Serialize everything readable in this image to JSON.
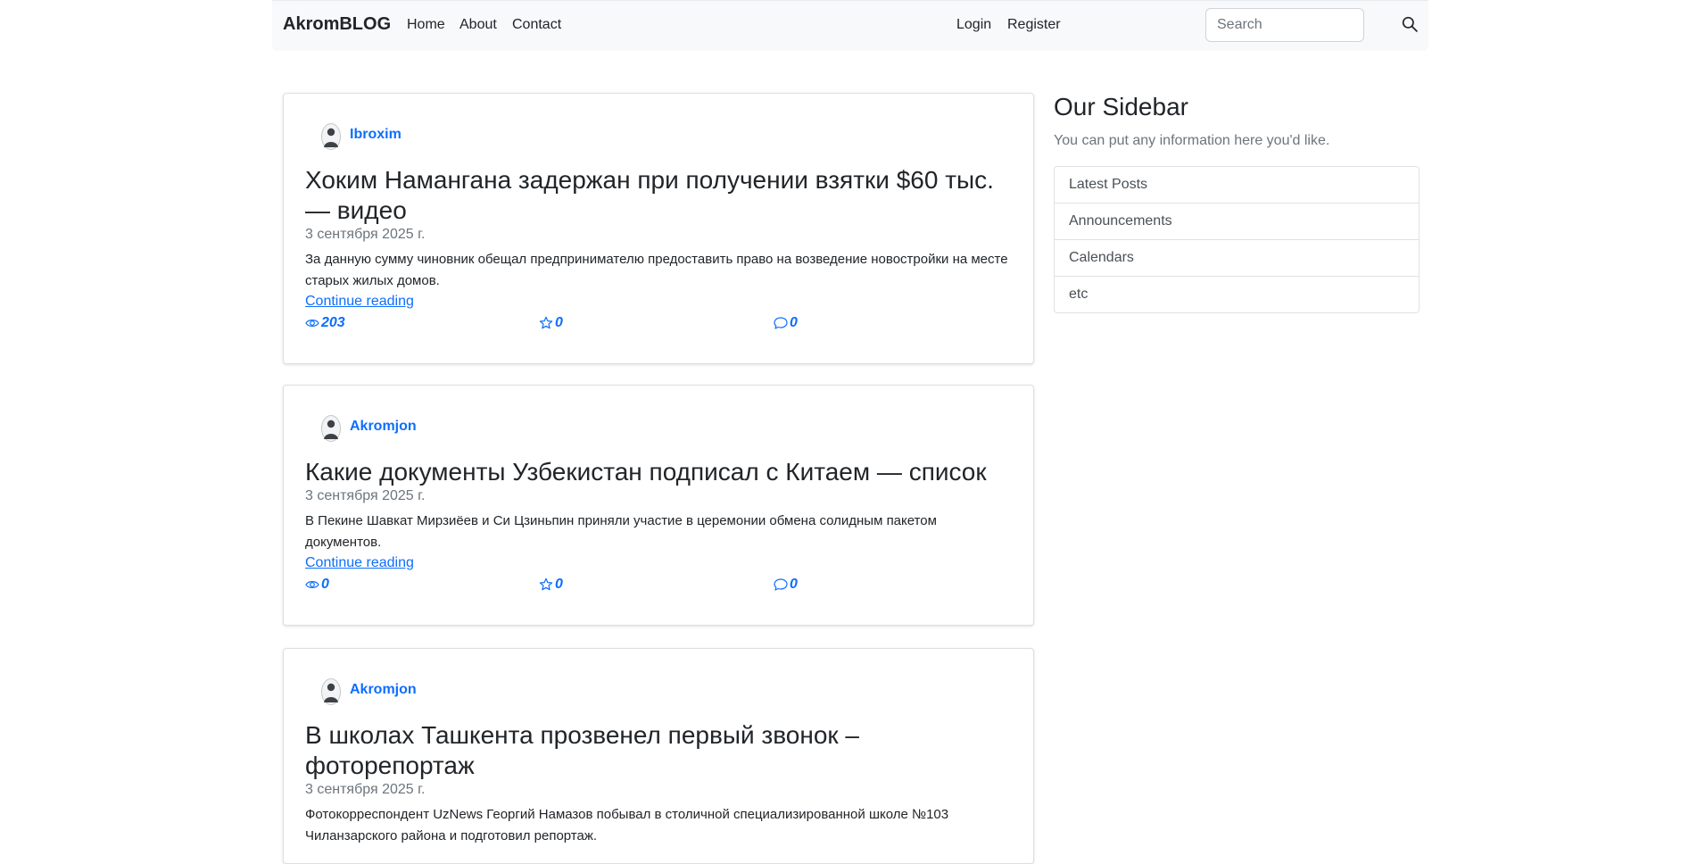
{
  "navbar": {
    "brand": "AkromBLOG",
    "links": [
      "Home",
      "About",
      "Contact"
    ],
    "auth": [
      "Login",
      "Register"
    ],
    "search_placeholder": "Search"
  },
  "posts": [
    {
      "author": "Ibroxim",
      "title": "Хоким Намангана задержан при получении взятки $60 тыс. — видео",
      "date": "3 сентября 2025 г.",
      "excerpt": "За данную сумму чиновник обещал предпринимателю предоставить право на возведение новостройки на месте старых жилых домов.",
      "continue": "Continue reading",
      "views": "203",
      "likes": "0",
      "comments": "0"
    },
    {
      "author": "Akromjon",
      "title": "Какие документы Узбекистан подписал с Китаем — список",
      "date": "3 сентября 2025 г.",
      "excerpt": "В Пекине Шавкат Мирзиёев и Си Цзиньпин приняли участие в церемонии обмена солидным пакетом документов.",
      "continue": "Continue reading",
      "views": "0",
      "likes": "0",
      "comments": "0"
    },
    {
      "author": "Akromjon",
      "title": "В школах Ташкента прозвенел первый звонок – фоторепортаж",
      "date": "3 сентября 2025 г.",
      "excerpt": "Фотокорреспондент UzNews Георгий Намазов побывал в столичной специализированной школе №103 Чиланзарского района и подготовил репортаж."
    }
  ],
  "sidebar": {
    "title": "Our Sidebar",
    "text": "You can put any information here you'd like.",
    "items": [
      "Latest Posts",
      "Announcements",
      "Calendars",
      "etc"
    ]
  },
  "colors": {
    "accent": "#0d6efd",
    "navbar_bg": "#f8f9fa",
    "muted": "#6c757d"
  }
}
